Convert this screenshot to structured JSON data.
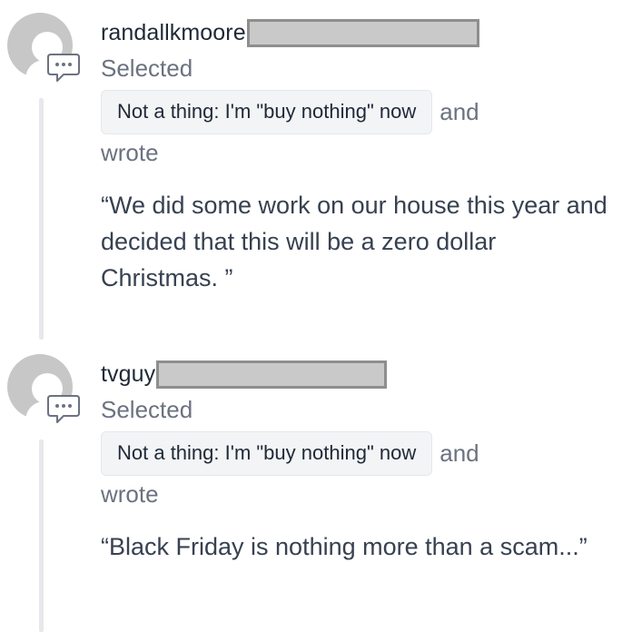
{
  "entries": [
    {
      "username": "randallkmoore",
      "status": "Selected",
      "tag": "Not a thing: I'm \"buy nothing\" now",
      "conjunction": "and",
      "verb": "wrote",
      "quote": "“We did some work on our house this year and decided that this will be a zero dollar Christmas. ”"
    },
    {
      "username": "tvguy",
      "status": "Selected",
      "tag": "Not a thing: I'm \"buy nothing\" now",
      "conjunction": "and",
      "verb": "wrote",
      "quote": "“Black Friday is nothing more than a scam...”"
    }
  ],
  "icons": {
    "avatar": "default-avatar-icon",
    "comment": "comment-bubble-icon"
  },
  "colors": {
    "text_primary": "#1f2937",
    "text_muted": "#6b7280",
    "chip_bg": "#f3f4f6",
    "redaction_fill": "#c9c9c9",
    "redaction_border": "#8e8e8e",
    "avatar_gray": "#c7c7c7"
  }
}
